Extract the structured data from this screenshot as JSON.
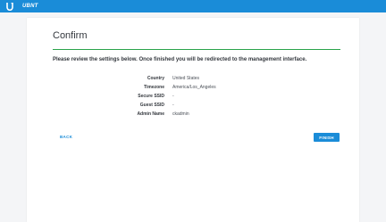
{
  "header": {
    "brand": "UBNT",
    "logo_icon": "ubnt-u-logo-icon",
    "accent": "#1a8cd8"
  },
  "main": {
    "title": "Confirm",
    "intro": "Please review the settings below. Once finished you will be redirected to the management interface.",
    "settings": [
      {
        "label": "Country",
        "value": "United States"
      },
      {
        "label": "Timezone",
        "value": "America/Los_Angeles"
      },
      {
        "label": "Secure SSID",
        "value": "-"
      },
      {
        "label": "Guest SSID",
        "value": "-"
      },
      {
        "label": "Admin Name",
        "value": "ckadmin"
      }
    ],
    "back_label": "BACK",
    "finish_label": "FINISH",
    "divider_color": "#2aa44a"
  }
}
